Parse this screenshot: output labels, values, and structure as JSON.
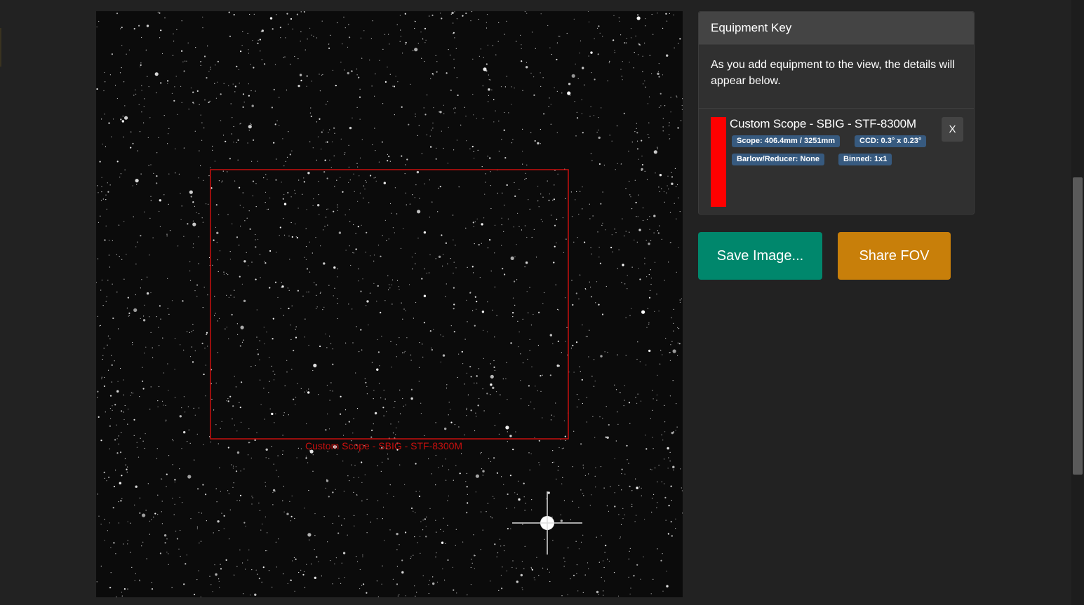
{
  "starfield": {
    "fov_label": "Custom Scope - SBIG - STF-8300M",
    "fov_color": "#c8100e"
  },
  "equipment_key": {
    "title": "Equipment Key",
    "intro": "As you add equipment to the view, the details will appear below.",
    "item": {
      "name": "Custom Scope - SBIG - STF-8300M",
      "swatch_color": "#ff0000",
      "badges": {
        "scope": "Scope: 406.4mm / 3251mm",
        "ccd": "CCD: 0.3° x 0.23°",
        "barlow": "Barlow/Reducer: None",
        "binned": "Binned: 1x1"
      },
      "remove_label": "X"
    }
  },
  "actions": {
    "save_label": "Save Image...",
    "share_label": "Share FOV"
  },
  "colors": {
    "background": "#222222",
    "save_button": "#00876c",
    "share_button": "#c87f0a",
    "badge": "#375a7f"
  }
}
